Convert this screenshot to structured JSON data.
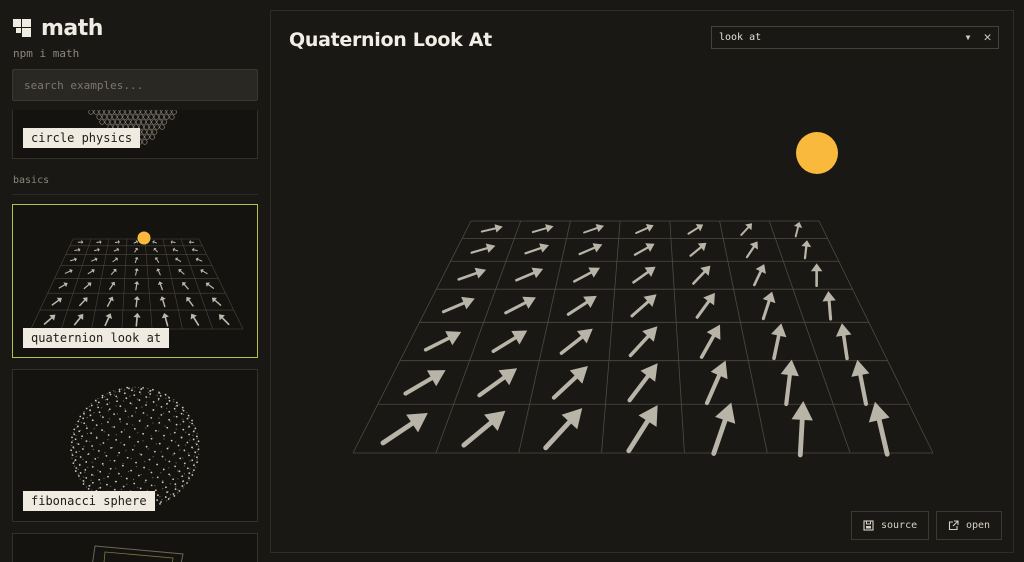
{
  "brand": {
    "title": "math",
    "install": "npm i math"
  },
  "search": {
    "placeholder": "search examples..."
  },
  "sidebar": {
    "section_basics": "basics",
    "cards": [
      {
        "label": "circle physics"
      },
      {
        "label": "quaternion look at"
      },
      {
        "label": "fibonacci sphere"
      }
    ]
  },
  "main": {
    "title": "Quaternion Look At",
    "select_value": "look at",
    "source_label": "source",
    "open_label": "open"
  },
  "colors": {
    "accent": "#b8c24a",
    "sun": "#f9b93c",
    "background": "#1a1814"
  },
  "icons": [
    "logo-icon",
    "chevron-down-icon",
    "close-icon",
    "file-icon",
    "external-link-icon"
  ]
}
